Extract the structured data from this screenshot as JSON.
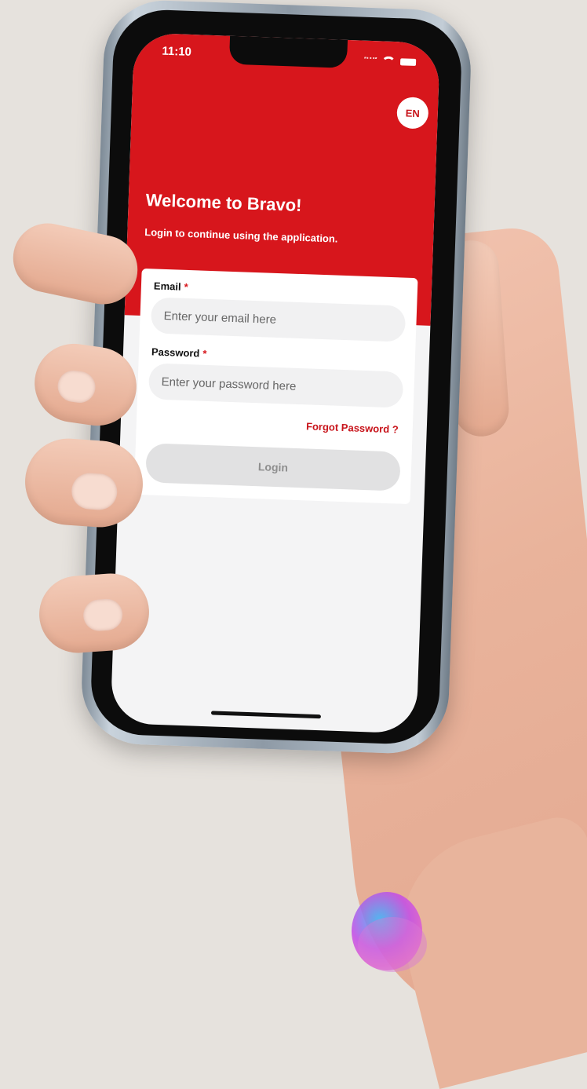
{
  "status_bar": {
    "time": "11:10"
  },
  "header": {
    "language_code": "EN",
    "title": "Welcome to Bravo!",
    "subtitle": "Login to continue using the application."
  },
  "form": {
    "email_label": "Email",
    "email_required_mark": "*",
    "email_placeholder": "Enter your email here",
    "password_label": "Password",
    "password_required_mark": "*",
    "password_placeholder": "Enter your password here",
    "forgot_password": "Forgot Password ?",
    "login_button": "Login"
  },
  "colors": {
    "brand_red": "#d7161c",
    "button_disabled": "#e1e1e2",
    "background": "#e6e2dd"
  },
  "icons": [
    "wifi-icon",
    "battery-icon",
    "signal-icon"
  ]
}
